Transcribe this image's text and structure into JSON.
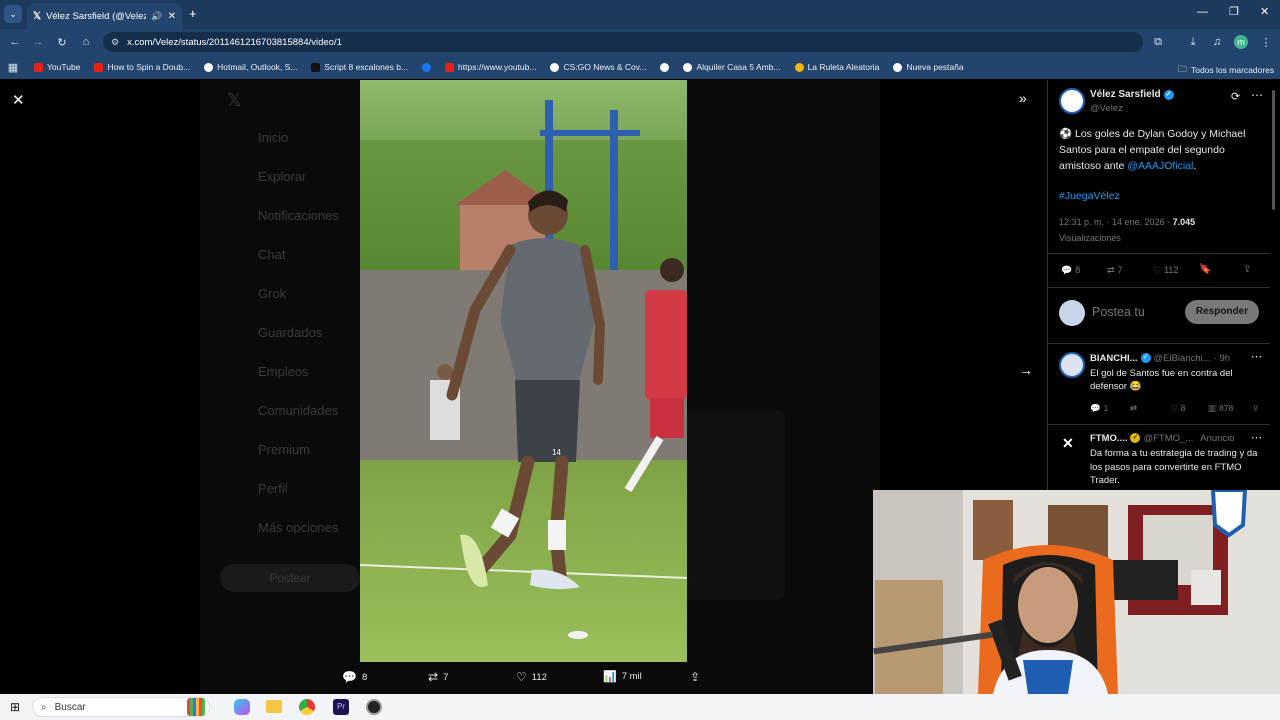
{
  "browser": {
    "tab_title": "Vélez Sarsfield (@Velez) / X",
    "url": "x.com/Velez/status/2011461216703815884/video/1",
    "bookmarks": [
      "YouTube",
      "How to Spin a Doub...",
      "Hotmail, Outlook, S...",
      "Script 8 escalones b...",
      "https://www.youtub...",
      "CS:GO News & Cov...",
      "Alquiler Casa 5 Amb...",
      "La Ruleta Aleatoria",
      "Nueva pestaña"
    ],
    "all_bookmarks": "Todos los marcadores",
    "profile_letter": "m"
  },
  "background_nav": [
    "Inicio",
    "Explorar",
    "Notificaciones",
    "Chat",
    "Grok",
    "Guardados",
    "Empleos",
    "Comunidades",
    "Premium",
    "Perfil",
    "Más opciones"
  ],
  "background_post_button": "Postear",
  "media": {
    "player_number": "14",
    "actions": {
      "replies": "8",
      "reposts": "7",
      "likes": "112",
      "views": "7 mil"
    }
  },
  "tweet": {
    "author_name": "Vélez Sarsfield",
    "author_handle": "@Velez",
    "text_part1": "⚽ Los goles de Dylan Godoy y Michael Santos para el empate del segundo amistoso ante ",
    "mention": "@AAAJOficial",
    "text_part2": ".",
    "hashtag": "#JuegaVélez",
    "timestamp": "12:31 p. m. · 14 ene. 2026 · ",
    "views_count": "7.045",
    "views_label": "Visualizaciones",
    "replies": "8",
    "reposts": "7",
    "likes": "112",
    "reply_placeholder": "Postea tu",
    "reply_button": "Responder"
  },
  "replies": [
    {
      "name": "BIANCHI...",
      "handle": "@ElBianchi...",
      "time": "· 9h",
      "text": "El gol de Santos fue en contra del defensor 😂",
      "replies": "1",
      "reposts": "",
      "likes": "8",
      "views": "878"
    },
    {
      "name": "FTMO....",
      "handle": "@FTMO_...",
      "time": "Anuncio",
      "text": "Da forma a tu estrategia de trading y da los pasos para convertirte en FTMO Trader."
    }
  ],
  "taskbar": {
    "search_placeholder": "Buscar"
  },
  "colors": {
    "accent": "#1d9bf0",
    "browser_frame": "#23456d",
    "verified": "#1d9bf0",
    "gold_badge": "#e2b719"
  }
}
